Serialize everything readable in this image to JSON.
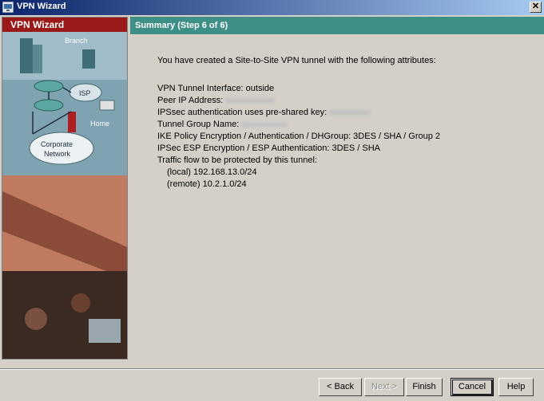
{
  "window": {
    "title": "VPN Wizard",
    "close_glyph": "✕"
  },
  "left": {
    "header": "VPN Wizard",
    "labels": {
      "branch": "Branch",
      "isp": "ISP",
      "home": "Home",
      "corporate": "Corporate",
      "network": "Network"
    }
  },
  "header": {
    "title": "Summary  (Step 6 of 6)"
  },
  "summary": {
    "intro": "You have created a Site-to-Site VPN tunnel with the following attributes:",
    "tunnel_interface": "VPN Tunnel Interface: outside",
    "peer_ip_label": "Peer IP Address:",
    "psk_label": "IPSsec authentication uses pre-shared key:",
    "tunnel_group_label": "Tunnel Group Name:",
    "ike_policy": "IKE Policy Encryption / Authentication / DHGroup: 3DES / SHA / Group 2",
    "esp": "IPSec ESP Encryption / ESP Authentication: 3DES / SHA",
    "traffic_label": "Traffic flow to be protected by this tunnel:",
    "local_net": "(local) 192.168.13.0/24",
    "remote_net": "(remote) 10.2.1.0/24"
  },
  "buttons": {
    "back": "< Back",
    "next": "Next >",
    "finish": "Finish",
    "cancel": "Cancel",
    "help": "Help"
  },
  "icons": {
    "app": "vpn-wizard-icon",
    "close": "close-icon"
  },
  "colors": {
    "title_bar": "#0a246a",
    "left_header": "#9a1a1a",
    "right_header": "#3e8f86",
    "background": "#d4d0c8"
  }
}
